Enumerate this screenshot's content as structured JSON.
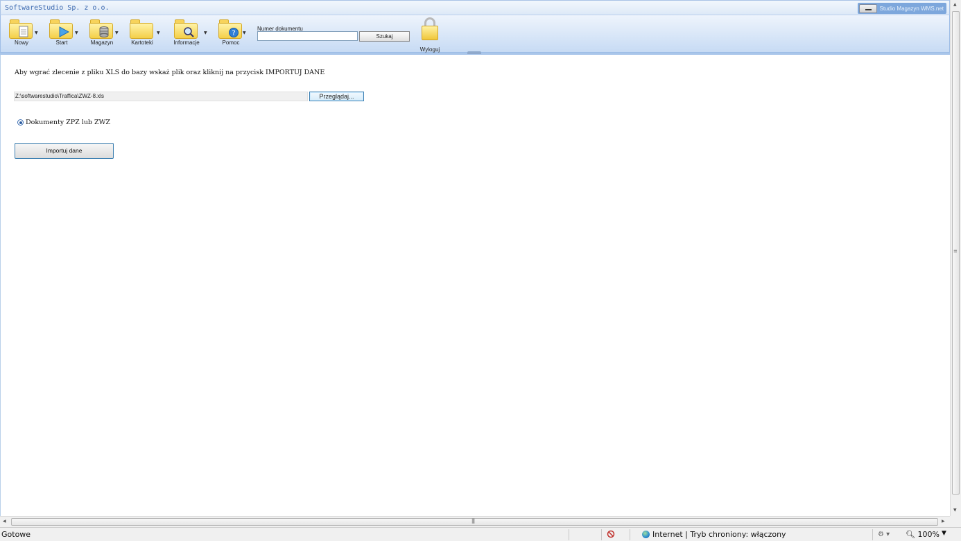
{
  "header": {
    "company": "SoftwareStudio Sp. z o.o.",
    "app_name": "Studio Magazyn WMS.net"
  },
  "toolbar": {
    "items": [
      {
        "label": "Nowy",
        "icon": "new-document-folder-icon"
      },
      {
        "label": "Start",
        "icon": "start-play-folder-icon"
      },
      {
        "label": "Magazyn",
        "icon": "warehouse-database-folder-icon"
      },
      {
        "label": "Kartoteki",
        "icon": "folder-icon"
      },
      {
        "label": "Informacje",
        "icon": "info-search-folder-icon"
      },
      {
        "label": "Pomoc",
        "icon": "help-folder-icon"
      }
    ],
    "search_label": "Numer dokumentu",
    "search_value": "",
    "search_button": "Szukaj",
    "logout_label": "Wyloguj"
  },
  "main": {
    "instruction": "Aby wgrać zlecenie z pliku XLS do bazy wskaż plik oraz kliknij na przycisk IMPORTUJ DANE",
    "file_path": "Z:\\softwarestudio\\Traffica\\ZWZ-8.xls",
    "browse_button": "Przeglądaj...",
    "radio_label": "Dokumenty ZPZ lub ZWZ",
    "import_button": "Importuj dane"
  },
  "statusbar": {
    "status": "Gotowe",
    "zone": "Internet | Tryb chroniony: włączony",
    "zoom": "100%"
  },
  "colors": {
    "toolbar_top": "#eef4fc",
    "toolbar_bottom": "#c7dbf4",
    "folder": "#f4cf48",
    "button_border": "#3c7fb1"
  }
}
